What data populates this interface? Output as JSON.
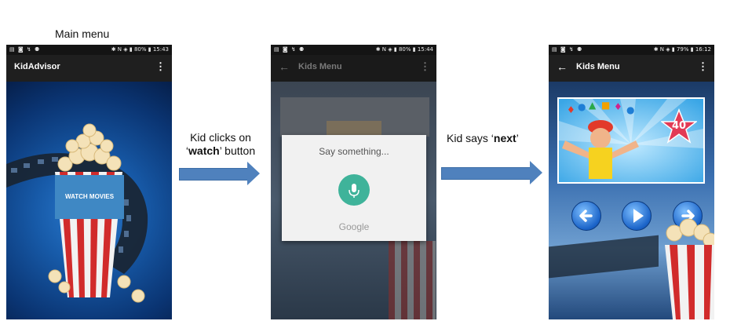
{
  "captions": {
    "main_menu": "Main menu",
    "kid_clicks_line1": "Kid clicks on",
    "kid_clicks_q1": "‘",
    "kid_clicks_bold": "watch",
    "kid_clicks_rest": "’ button",
    "kid_says_prefix": "Kid says ‘",
    "kid_says_bold": "next",
    "kid_says_suffix": "’"
  },
  "screen1": {
    "status_icons": "▤ ◙ ↯ ⚉",
    "status_right": "✱ N ◈ ▮ 80% ▮ 15:43",
    "title": "KidAdvisor",
    "watch_button": "WATCH MOVIES"
  },
  "screen2": {
    "status_icons": "▤ ◙ ↯ ⚉",
    "status_right": "✱ N ◈ ▮ 80% ▮ 15:44",
    "title": "Kids Menu",
    "dialog_prompt": "Say something...",
    "dialog_brand": "Google"
  },
  "screen3": {
    "status_icons": "▤ ◙ ↯ ⚉",
    "status_right": "✱ N ◈ ▮ 79% ▮ 16:12",
    "title": "Kids Menu",
    "badge_text": "40"
  },
  "colors": {
    "arrow": "#4f81bd",
    "watch_button": "#3f88c4",
    "mic": "#3fb39a"
  }
}
